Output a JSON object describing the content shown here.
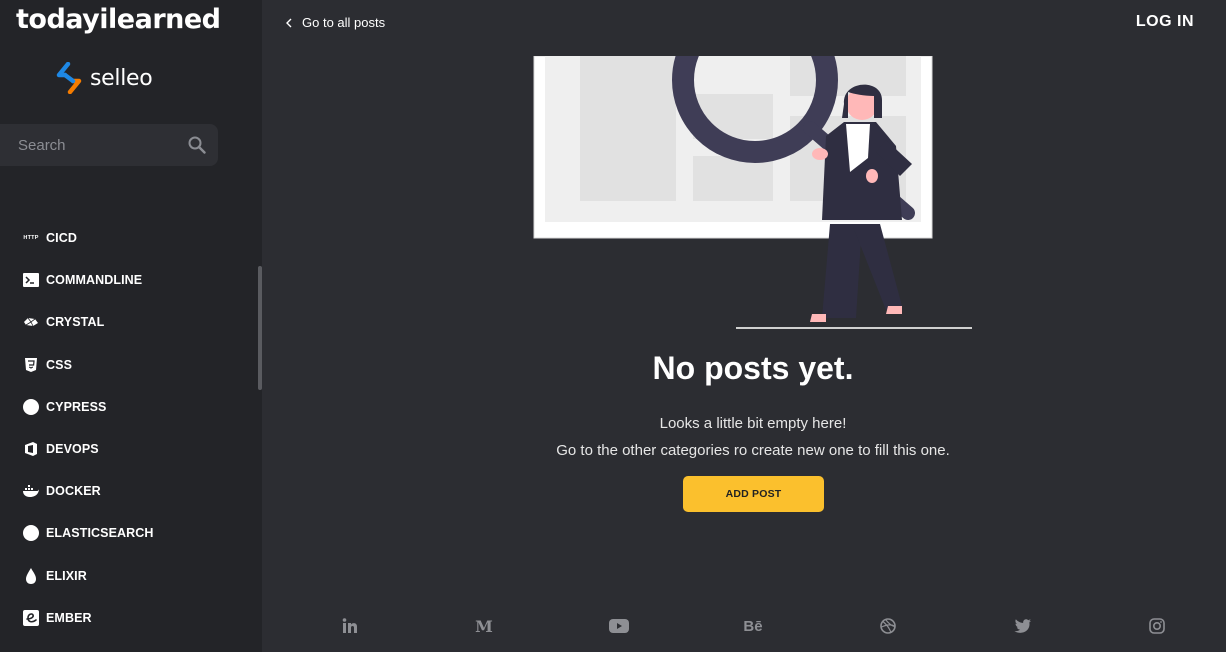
{
  "sidebar": {
    "brand": "todayilearned",
    "company": "selleo",
    "search": {
      "placeholder": "Search"
    },
    "categories": [
      {
        "label": "CICD",
        "icon": "http-icon"
      },
      {
        "label": "COMMANDLINE",
        "icon": "terminal-icon"
      },
      {
        "label": "CRYSTAL",
        "icon": "crystal-icon"
      },
      {
        "label": "CSS",
        "icon": "css3-icon"
      },
      {
        "label": "CYPRESS",
        "icon": "cypress-icon"
      },
      {
        "label": "DEVOPS",
        "icon": "devops-icon"
      },
      {
        "label": "DOCKER",
        "icon": "docker-icon"
      },
      {
        "label": "ELASTICSEARCH",
        "icon": "elasticsearch-icon"
      },
      {
        "label": "ELIXIR",
        "icon": "elixir-icon"
      },
      {
        "label": "EMBER",
        "icon": "ember-icon"
      }
    ]
  },
  "header": {
    "back_label": "Go to all posts",
    "login_label": "LOG IN"
  },
  "main": {
    "empty_title": "No posts yet.",
    "empty_line1": "Looks a little bit empty here!",
    "empty_line2": "Go to the other categories ro create new one to fill this one.",
    "add_post_label": "ADD POST"
  },
  "footer": {
    "social": [
      "linkedin-icon",
      "medium-icon",
      "youtube-icon",
      "behance-icon",
      "dribbble-icon",
      "twitter-icon",
      "instagram-icon"
    ],
    "medium_glyph": "M",
    "behance_glyph": "Bē",
    "http_glyph": "HTTP",
    "http_glyph_note": ""
  },
  "colors": {
    "background": "#2c2d32",
    "sidebar": "#232428",
    "accent": "#fbc02d",
    "logo_blue": "#1e88e5",
    "logo_orange": "#f57c00"
  }
}
